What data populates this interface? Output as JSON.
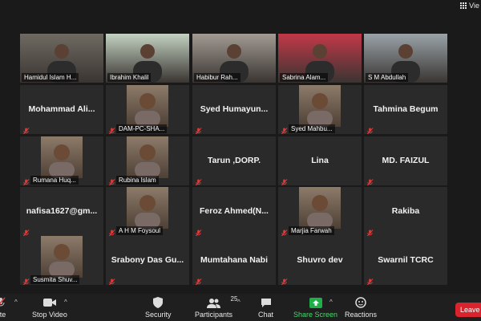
{
  "top_bar": {
    "view_label": "Vie"
  },
  "tiles": [
    {
      "name": "Hamidul Islam H...",
      "type": "video"
    },
    {
      "name": "Ibrahim Khalil",
      "type": "video"
    },
    {
      "name": "Habibur Rah...",
      "type": "video"
    },
    {
      "name": "Sabrina Alam...",
      "type": "video"
    },
    {
      "name": "S M Abdullah",
      "type": "video",
      "active": true
    },
    {
      "name": "Mohammad Ali...",
      "type": "text"
    },
    {
      "name": "DAM-PC-SHA...",
      "type": "photo"
    },
    {
      "name": "Syed Humayun...",
      "type": "text"
    },
    {
      "name": "Syed Mahbu...",
      "type": "photo"
    },
    {
      "name": "Tahmina Begum",
      "type": "text"
    },
    {
      "name": "Rumana Huq...",
      "type": "photo"
    },
    {
      "name": "Rubina Islam",
      "type": "photo"
    },
    {
      "name": "Tarun ,DORP.",
      "type": "text"
    },
    {
      "name": "Lina",
      "type": "text"
    },
    {
      "name": "MD. FAIZUL",
      "type": "text"
    },
    {
      "name": "nafisa1627@gm...",
      "type": "text"
    },
    {
      "name": "A H M Foysoul",
      "type": "photo"
    },
    {
      "name": "Feroz Ahmed(N...",
      "type": "text"
    },
    {
      "name": "Marjia Farwah",
      "type": "photo"
    },
    {
      "name": "Rakiba",
      "type": "text"
    },
    {
      "name": "Susmita Shuv...",
      "type": "photo"
    },
    {
      "name": "Srabony Das Gu...",
      "type": "text"
    },
    {
      "name": "Mumtahana Nabi",
      "type": "text"
    },
    {
      "name": "Shuvro dev",
      "type": "text"
    },
    {
      "name": "Swarnil TCRC",
      "type": "text"
    }
  ],
  "toolbar": {
    "mute_label": "ute",
    "stop_video_label": "Stop Video",
    "security_label": "Security",
    "participants_label": "Participants",
    "participants_count": "25",
    "chat_label": "Chat",
    "share_screen_label": "Share Screen",
    "reactions_label": "Reactions",
    "leave_label": "Leave"
  },
  "colors": {
    "background": "#1a1a1a",
    "tile": "#2a2a2a",
    "active_border": "#d8d25a",
    "muted_red": "#e03a3a",
    "share_green": "#1fae48",
    "leave_red": "#d9232d"
  }
}
